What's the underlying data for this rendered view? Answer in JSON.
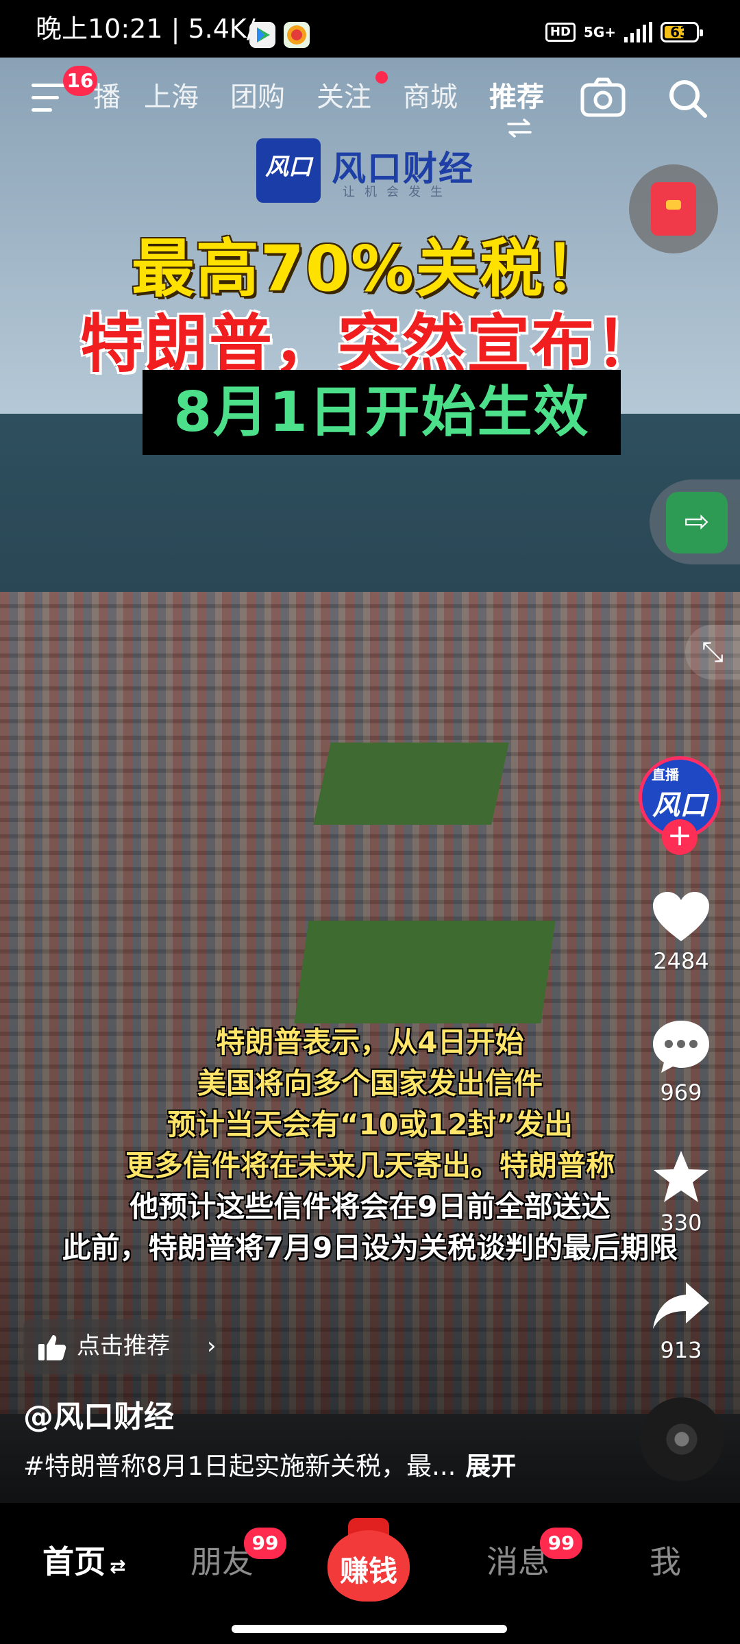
{
  "status_bar": {
    "time_and_speed": "晚上10:21 | 5.4K/s",
    "hd": "HD",
    "network": "5G+",
    "battery": "63",
    "battery_fraction": 0.63
  },
  "top_nav": {
    "menu_badge": "16",
    "tabs": [
      {
        "label": "播",
        "active": false
      },
      {
        "label": "上海",
        "active": false
      },
      {
        "label": "团购",
        "active": false
      },
      {
        "label": "关注",
        "active": false,
        "dot": true
      },
      {
        "label": "商城",
        "active": false
      },
      {
        "label": "推荐",
        "active": true
      }
    ],
    "icons": [
      "menu-icon",
      "camera-icon",
      "search-icon",
      "swap-icon"
    ]
  },
  "video": {
    "logo_mark": "风口",
    "logo_name": "风口财经",
    "logo_slogan": "让机会发生",
    "headline_1": "最高70%关税！",
    "headline_2": "特朗普，突然宣布！",
    "headline_3": "8月1日开始生效",
    "subtitles": [
      "特朗普表示，从4日开始",
      "美国将向多个国家发出信件",
      "预计当天会有“10或12封”发出",
      "更多信件将在未来几天寄出。特朗普称",
      "他预计这些信件将会在9日前全部送达",
      "此前，特朗普将7月9日设为关税谈判的最后期限"
    ],
    "subtitle_colors": [
      "#ffe56a",
      "#ffe56a",
      "#ffe56a",
      "#ffe56a",
      "#ffffff",
      "#ffffff"
    ]
  },
  "right_rail": {
    "avatar_live_label": "直播",
    "avatar_mark": "风口",
    "likes": "2484",
    "comments": "969",
    "favorites": "330",
    "shares": "913"
  },
  "post": {
    "recommend_label": "点击推荐",
    "author": "@风口财经",
    "caption": "#特朗普称8月1日起实施新关税，最...",
    "expand": "展开"
  },
  "bottom_nav": {
    "home": "首页",
    "friends": "朋友",
    "friends_badge": "99",
    "earn": "赚钱",
    "messages": "消息",
    "messages_badge": "99",
    "me": "我"
  },
  "colors": {
    "accent_red": "#ff2a4d",
    "headline_yellow": "#ffe100",
    "headline_red": "#f01e1e",
    "headline_green": "#4ce08b"
  }
}
